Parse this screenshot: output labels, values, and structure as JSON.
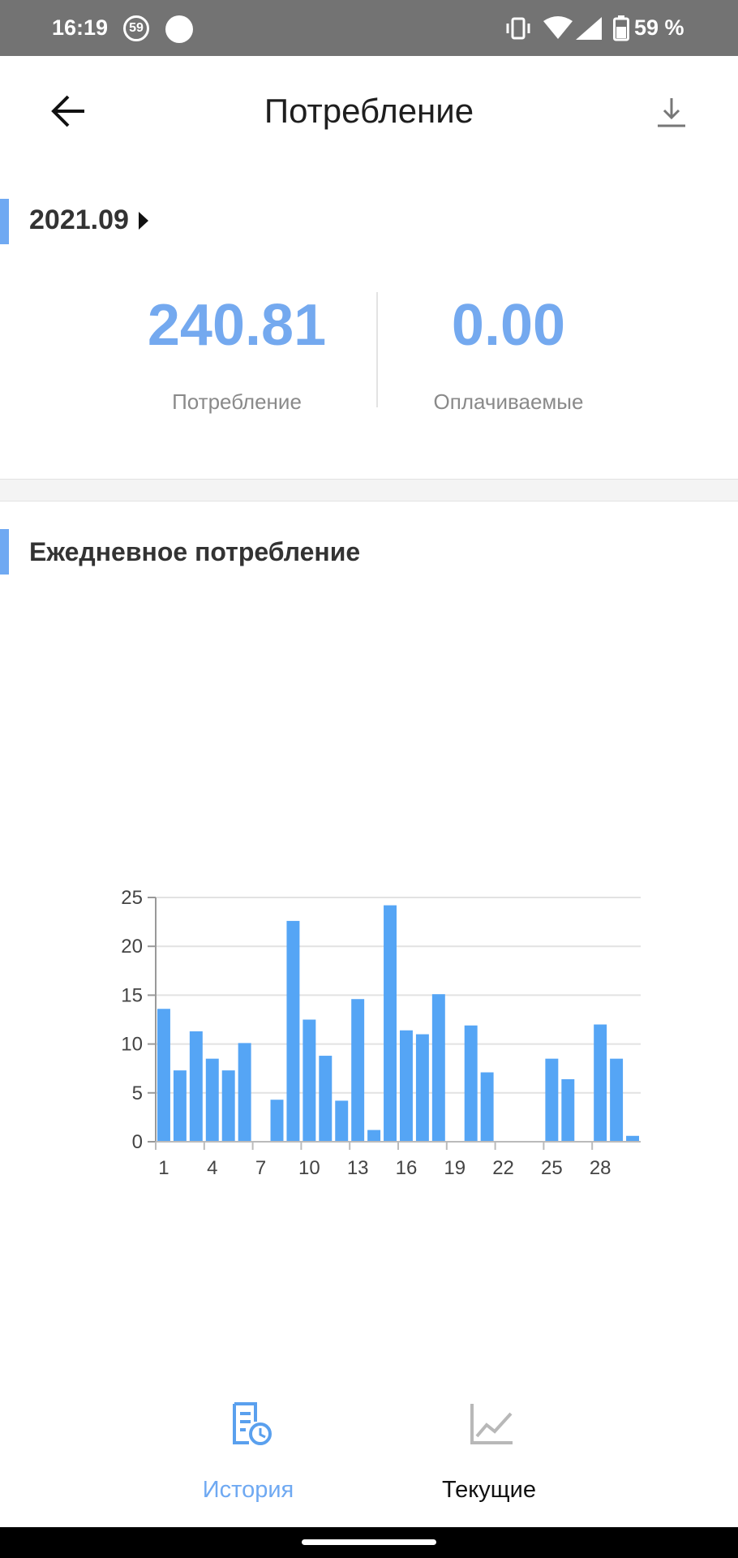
{
  "status_bar": {
    "time": "16:19",
    "badge": "59",
    "battery_text": "59 %"
  },
  "header": {
    "title": "Потребление",
    "back_icon": "arrow-left-icon",
    "download_icon": "download-icon"
  },
  "summary": {
    "period": "2021.09",
    "consumption_value": "240.81",
    "consumption_label": "Потребление",
    "billable_value": "0.00",
    "billable_label": "Оплачиваемые"
  },
  "daily": {
    "title": "Ежедневное потребление"
  },
  "colors": {
    "accent": "#6fa9f2",
    "value_blue": "#74a9ef",
    "bar": "#55a5f5",
    "status_bar": "#737373"
  },
  "chart_data": {
    "type": "bar",
    "x": [
      1,
      2,
      3,
      4,
      5,
      6,
      7,
      8,
      9,
      10,
      11,
      12,
      13,
      14,
      15,
      16,
      17,
      18,
      19,
      20,
      21,
      22,
      23,
      24,
      25,
      26,
      27,
      28,
      29,
      30
    ],
    "values": [
      13.6,
      7.3,
      11.3,
      8.5,
      7.3,
      10.1,
      0,
      4.3,
      22.6,
      12.5,
      8.8,
      4.2,
      14.6,
      1.2,
      24.2,
      11.4,
      11.0,
      15.1,
      0,
      11.9,
      7.1,
      0,
      0,
      0,
      8.5,
      6.4,
      0,
      12.0,
      8.5,
      0.6
    ],
    "xticks": [
      "1",
      "4",
      "7",
      "10",
      "13",
      "16",
      "19",
      "22",
      "25",
      "28"
    ],
    "yticks": [
      "0",
      "5",
      "10",
      "15",
      "20",
      "25"
    ],
    "ylim": [
      0,
      25
    ],
    "grid": true
  },
  "bottom_nav": {
    "items": [
      {
        "label": "История",
        "icon": "history-document-icon",
        "active": true
      },
      {
        "label": "Текущие",
        "icon": "line-chart-icon",
        "active": false
      }
    ]
  }
}
